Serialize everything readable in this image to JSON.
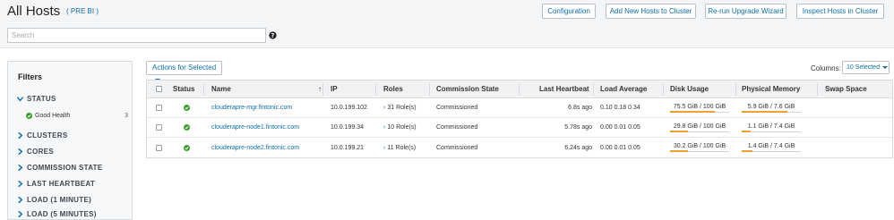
{
  "header": {
    "title": "All Hosts",
    "cluster_link": "( PRE BI )",
    "buttons": {
      "configuration": "Configuration",
      "add_hosts": "Add New Hosts to Cluster",
      "upgrade_wizard": "Re-run Upgrade Wizard",
      "inspect_hosts": "Inspect Hosts in Cluster"
    },
    "search_placeholder": "Search"
  },
  "filters": {
    "title": "Filters",
    "groups": [
      "STATUS",
      "CLUSTERS",
      "CORES",
      "COMMISSION STATE",
      "LAST HEARTBEAT",
      "LOAD (1 MINUTE)",
      "LOAD (5 MINUTES)"
    ],
    "status_option": {
      "label": "Good Health",
      "count": "3"
    }
  },
  "toolbar": {
    "actions_label": "Actions for Selected",
    "columns_label": "Columns:",
    "columns_value": "10 Selected"
  },
  "table": {
    "headers": {
      "status": "Status",
      "name": "Name",
      "ip": "IP",
      "roles": "Roles",
      "commission_state": "Commission State",
      "last_heartbeat": "Last Heartbeat",
      "load_average": "Load Average",
      "disk_usage": "Disk Usage",
      "physical_memory": "Physical Memory",
      "swap_space": "Swap Space"
    },
    "sort_indicator": "↑",
    "rows": [
      {
        "name": "clouderapre-mgr.fintonic.com",
        "ip": "10.0.199.102",
        "roles": "31 Role(s)",
        "commission_state": "Commissioned",
        "last_heartbeat": "6.8s ago",
        "load_average": "0.10  0.18  0.34",
        "disk_usage": "75.5 GiB / 100 GiB",
        "disk_fraction": 0.755,
        "physical_memory": "5.9 GiB / 7.6 GiB",
        "memory_fraction": 0.776,
        "swap_space": ""
      },
      {
        "name": "clouderapre-node1.fintonic.com",
        "ip": "10.0.199.34",
        "roles": "10 Role(s)",
        "commission_state": "Commissioned",
        "last_heartbeat": "5.78s ago",
        "load_average": "0.00  0.01  0.05",
        "disk_usage": "29.8 GiB / 100 GiB",
        "disk_fraction": 0.298,
        "physical_memory": "1.1 GiB / 7.4 GiB",
        "memory_fraction": 0.149,
        "swap_space": ""
      },
      {
        "name": "clouderapre-node2.fintonic.com",
        "ip": "10.0.199.21",
        "roles": "11 Role(s)",
        "commission_state": "Commissioned",
        "last_heartbeat": "6.24s ago",
        "load_average": "0.00  0.01  0.05",
        "disk_usage": "30.2 GiB / 100 GiB",
        "disk_fraction": 0.302,
        "physical_memory": "1.4 GiB / 7.4 GiB",
        "memory_fraction": 0.189,
        "swap_space": ""
      }
    ]
  },
  "colors": {
    "link": "#0f6ea8",
    "good": "#3c9a2f",
    "disk_fill": "#f0a030",
    "memory_fill": "#f0a030"
  },
  "icons": {
    "status_ok": "check-circle-icon",
    "help": "question-circle-icon",
    "chevron_right": "chevron-right-icon",
    "chevron_down": "chevron-down-icon"
  }
}
